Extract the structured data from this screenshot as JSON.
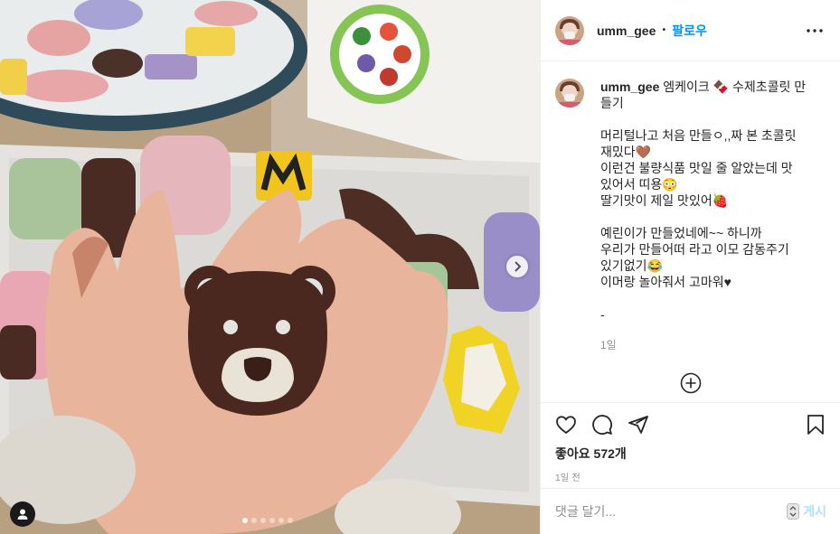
{
  "post": {
    "username": "umm_gee",
    "separator": "•",
    "follow_label": "팔로우",
    "caption_lines": [
      "엠케이크 🍫 수제초콜릿 만",
      "들기",
      "",
      "머리털나고 처음 만들ㅇ,,짜 본 초콜릿",
      "재밌다🤎",
      "이런건 불량식품 맛일 줄 알았는데 맛",
      "있어서 띠용😳",
      "딸기맛이 제일 맛있어🍓",
      "",
      "예린이가 만들었네에~~ 하니까",
      "우리가 만들어떠 라고 이모 감동주기",
      "있기없기😂",
      "이머랑 놀아줘서 고마워♥",
      "",
      "-"
    ],
    "caption_age": "1일",
    "likes_label": "좋아요 572개",
    "posted_ago": "1일 전",
    "comment_placeholder": "댓글 달기...",
    "post_button": "게시",
    "carousel_count": 6,
    "carousel_active": 0
  },
  "colors": {
    "accent": "#0095f6",
    "text": "#262626",
    "muted": "#8e8e8e",
    "post_disabled": "#b2dffc"
  },
  "icons": [
    "more-options-icon",
    "load-more-comments-icon",
    "heart-icon",
    "comment-icon",
    "share-icon",
    "bookmark-icon",
    "emoji-icon",
    "carousel-next-icon",
    "user-tag-icon"
  ]
}
